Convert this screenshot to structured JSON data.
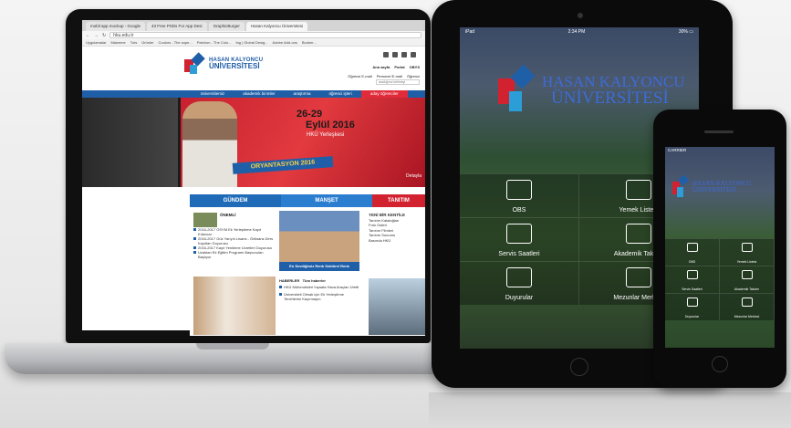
{
  "laptop": {
    "tabs": [
      "mobil app mockup - Google",
      "43 Free PSDs For App Desi",
      "GraphicBurger",
      "Hasan Kalyoncu Üniversitesi"
    ],
    "url": "hku.edu.tr",
    "bookmarks": [
      "Uygulamalar",
      "Malzeme",
      "Tuts",
      "Ürünler",
      "Coolors - The supe...",
      "Patchon - The Colo...",
      "fog | Global Desig...",
      "Adobe Add-ons",
      "Bookm..."
    ],
    "site": {
      "logo_line1": "HASAN KALYONCU",
      "logo_line2": "ÜNİVERSİTESİ",
      "top_links": [
        "Ana sayfa",
        "Portal",
        "OBYS",
        "Öğrenci E-mail",
        "Personel E-mail",
        "Öğrenci"
      ],
      "search_placeholder": "aradığınız kelimeyi",
      "nav": [
        "üniversitemiz",
        "akademik birimler",
        "araştırma",
        "öğrenci işleri",
        "aday öğrenciler"
      ],
      "hero": {
        "date1": "26-29",
        "date2": "Eylül 2016",
        "place": "HKÜ Yerleşkesi",
        "band": "ORYANTASYON 2016",
        "detail": "Detayla"
      },
      "tabs": [
        "GÜNDEM",
        "MANŞET",
        "TANITIM"
      ],
      "gundem": {
        "head": "ÖNEMLİ",
        "items": [
          "2016-2017 ÖSYM Ek Yerleştirme Kayıt Kılavuzu",
          "2016-2017 Güz Yarıyılı Lisans - Önlisans Ders Kayıtları Duyurusu",
          "2016-2017 Kayıt Yenileme Ücretleri Duyurusu",
          "Uzaktan Ek Eğitim Programı Başvuruları Başlıyor"
        ]
      },
      "manset_caption": "En Sevdiğimiz Renk Sektörel Renk",
      "tanitim": {
        "head": "YENİ BİR KENTİLE",
        "items": [
          "Tanıtım Kataloğları",
          "Foto Galeri",
          "Tanıtım Filmleri",
          "Tanıtım Sunumu",
          "Basında HKÜ"
        ]
      },
      "news": {
        "head": "HABERLER",
        "all": "Tüm haberler",
        "items": [
          "HKÜ Mühendisleri İnşaata Hava Araçları Üretti",
          "Üniversiteli Olmak için Ek Yerleştirme Tercihlerini Kaçırmayın"
        ]
      }
    }
  },
  "tablet": {
    "status_left": "iPad",
    "status_center": "2:34 PM",
    "status_right": "30% ▭",
    "brand_a": "HASAN KALYONCU",
    "brand_b": "ÜNİVERSİTESİ",
    "tiles": [
      "OBS",
      "Yemek Listesi",
      "Servis Saatleri",
      "Akademik Takvim",
      "Duyurular",
      "Mezunlar Merkezi"
    ]
  },
  "phone": {
    "status": "CARRIER",
    "brand_a": "HASAN KALYONCU",
    "brand_b": "ÜNİVERSİTESİ",
    "tiles": [
      "OBS",
      "Yemek Listesi",
      "Servis Saatleri",
      "Akademik Takvim",
      "Duyurular",
      "Mezunlar Merkezi"
    ]
  },
  "colors": {
    "brand_blue": "#1f5fa8",
    "brand_red": "#d3222f",
    "logo_blue": "#3d6bd8"
  }
}
